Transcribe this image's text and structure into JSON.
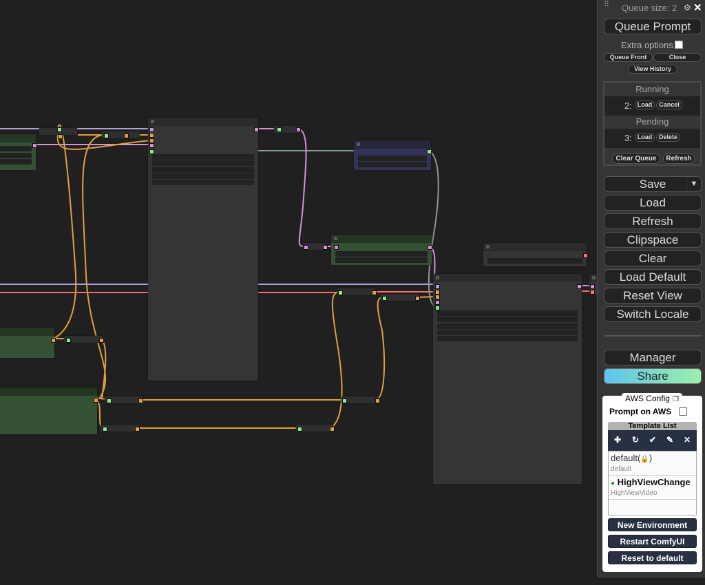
{
  "canvas": {
    "background": "#202020",
    "link_colors": {
      "clip": "#b39ddb",
      "model": "#e0a040",
      "conditioning": "#d88fd8",
      "vae": "#ff6e6e",
      "latent": "#d08fe0",
      "image": "#8a9a8a"
    }
  },
  "queue": {
    "size_label": "Queue size: 2",
    "queue_prompt": "Queue Prompt",
    "extra_options": "Extra options",
    "extra_options_checked": false,
    "queue_front": "Queue Front",
    "close": "Close",
    "view_history": "View History",
    "running_label": "Running",
    "running_item": {
      "number": "2:",
      "load": "Load",
      "action": "Cancel"
    },
    "pending_label": "Pending",
    "pending_item": {
      "number": "3:",
      "load": "Load",
      "action": "Delete"
    },
    "clear_queue": "Clear Queue",
    "refresh": "Refresh"
  },
  "menu": {
    "save": "Save",
    "save_dropdown_icon": "▼",
    "load": "Load",
    "refresh": "Refresh",
    "clipspace": "Clipspace",
    "clear": "Clear",
    "load_default": "Load Default",
    "reset_view": "Reset View",
    "switch_locale": "Switch Locale",
    "manager": "Manager",
    "share": "Share"
  },
  "aws": {
    "tab_label": "AWS Config",
    "prompt_on_aws": "Prompt on AWS",
    "prompt_on_aws_checked": false,
    "template_list_label": "Template List",
    "toolbar_icons": [
      "plus-icon",
      "refresh-icon",
      "check-icon",
      "edit-icon",
      "close-icon"
    ],
    "templates": [
      {
        "name": "default(",
        "lock": "🔒",
        "name_suffix": ")",
        "sub": "default",
        "active": false
      },
      {
        "name": "HighViewChange",
        "sub": "HighViewVideo",
        "active": true
      }
    ],
    "active_color": "#2e8b2e",
    "buttons": {
      "new_environment": "New Environment",
      "restart": "Restart ComfyUI",
      "reset_default": "Reset to default"
    }
  }
}
